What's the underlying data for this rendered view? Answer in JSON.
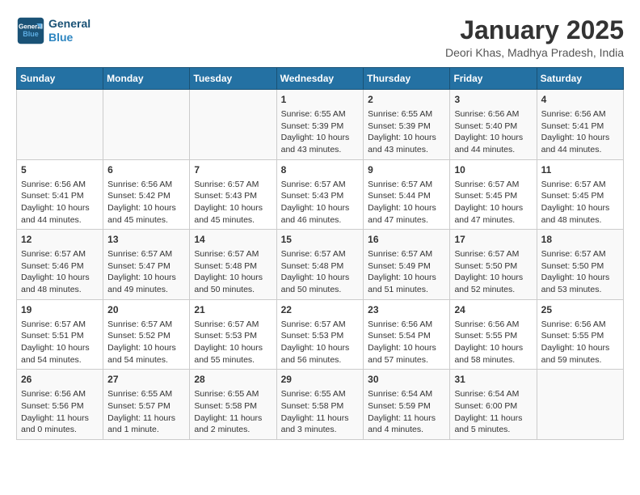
{
  "logo": {
    "line1": "General",
    "line2": "Blue"
  },
  "title": "January 2025",
  "subtitle": "Deori Khas, Madhya Pradesh, India",
  "days_of_week": [
    "Sunday",
    "Monday",
    "Tuesday",
    "Wednesday",
    "Thursday",
    "Friday",
    "Saturday"
  ],
  "weeks": [
    [
      {
        "day": "",
        "sunrise": "",
        "sunset": "",
        "daylight": ""
      },
      {
        "day": "",
        "sunrise": "",
        "sunset": "",
        "daylight": ""
      },
      {
        "day": "",
        "sunrise": "",
        "sunset": "",
        "daylight": ""
      },
      {
        "day": "1",
        "sunrise": "Sunrise: 6:55 AM",
        "sunset": "Sunset: 5:39 PM",
        "daylight": "Daylight: 10 hours and 43 minutes."
      },
      {
        "day": "2",
        "sunrise": "Sunrise: 6:55 AM",
        "sunset": "Sunset: 5:39 PM",
        "daylight": "Daylight: 10 hours and 43 minutes."
      },
      {
        "day": "3",
        "sunrise": "Sunrise: 6:56 AM",
        "sunset": "Sunset: 5:40 PM",
        "daylight": "Daylight: 10 hours and 44 minutes."
      },
      {
        "day": "4",
        "sunrise": "Sunrise: 6:56 AM",
        "sunset": "Sunset: 5:41 PM",
        "daylight": "Daylight: 10 hours and 44 minutes."
      }
    ],
    [
      {
        "day": "5",
        "sunrise": "Sunrise: 6:56 AM",
        "sunset": "Sunset: 5:41 PM",
        "daylight": "Daylight: 10 hours and 44 minutes."
      },
      {
        "day": "6",
        "sunrise": "Sunrise: 6:56 AM",
        "sunset": "Sunset: 5:42 PM",
        "daylight": "Daylight: 10 hours and 45 minutes."
      },
      {
        "day": "7",
        "sunrise": "Sunrise: 6:57 AM",
        "sunset": "Sunset: 5:43 PM",
        "daylight": "Daylight: 10 hours and 45 minutes."
      },
      {
        "day": "8",
        "sunrise": "Sunrise: 6:57 AM",
        "sunset": "Sunset: 5:43 PM",
        "daylight": "Daylight: 10 hours and 46 minutes."
      },
      {
        "day": "9",
        "sunrise": "Sunrise: 6:57 AM",
        "sunset": "Sunset: 5:44 PM",
        "daylight": "Daylight: 10 hours and 47 minutes."
      },
      {
        "day": "10",
        "sunrise": "Sunrise: 6:57 AM",
        "sunset": "Sunset: 5:45 PM",
        "daylight": "Daylight: 10 hours and 47 minutes."
      },
      {
        "day": "11",
        "sunrise": "Sunrise: 6:57 AM",
        "sunset": "Sunset: 5:45 PM",
        "daylight": "Daylight: 10 hours and 48 minutes."
      }
    ],
    [
      {
        "day": "12",
        "sunrise": "Sunrise: 6:57 AM",
        "sunset": "Sunset: 5:46 PM",
        "daylight": "Daylight: 10 hours and 48 minutes."
      },
      {
        "day": "13",
        "sunrise": "Sunrise: 6:57 AM",
        "sunset": "Sunset: 5:47 PM",
        "daylight": "Daylight: 10 hours and 49 minutes."
      },
      {
        "day": "14",
        "sunrise": "Sunrise: 6:57 AM",
        "sunset": "Sunset: 5:48 PM",
        "daylight": "Daylight: 10 hours and 50 minutes."
      },
      {
        "day": "15",
        "sunrise": "Sunrise: 6:57 AM",
        "sunset": "Sunset: 5:48 PM",
        "daylight": "Daylight: 10 hours and 50 minutes."
      },
      {
        "day": "16",
        "sunrise": "Sunrise: 6:57 AM",
        "sunset": "Sunset: 5:49 PM",
        "daylight": "Daylight: 10 hours and 51 minutes."
      },
      {
        "day": "17",
        "sunrise": "Sunrise: 6:57 AM",
        "sunset": "Sunset: 5:50 PM",
        "daylight": "Daylight: 10 hours and 52 minutes."
      },
      {
        "day": "18",
        "sunrise": "Sunrise: 6:57 AM",
        "sunset": "Sunset: 5:50 PM",
        "daylight": "Daylight: 10 hours and 53 minutes."
      }
    ],
    [
      {
        "day": "19",
        "sunrise": "Sunrise: 6:57 AM",
        "sunset": "Sunset: 5:51 PM",
        "daylight": "Daylight: 10 hours and 54 minutes."
      },
      {
        "day": "20",
        "sunrise": "Sunrise: 6:57 AM",
        "sunset": "Sunset: 5:52 PM",
        "daylight": "Daylight: 10 hours and 54 minutes."
      },
      {
        "day": "21",
        "sunrise": "Sunrise: 6:57 AM",
        "sunset": "Sunset: 5:53 PM",
        "daylight": "Daylight: 10 hours and 55 minutes."
      },
      {
        "day": "22",
        "sunrise": "Sunrise: 6:57 AM",
        "sunset": "Sunset: 5:53 PM",
        "daylight": "Daylight: 10 hours and 56 minutes."
      },
      {
        "day": "23",
        "sunrise": "Sunrise: 6:56 AM",
        "sunset": "Sunset: 5:54 PM",
        "daylight": "Daylight: 10 hours and 57 minutes."
      },
      {
        "day": "24",
        "sunrise": "Sunrise: 6:56 AM",
        "sunset": "Sunset: 5:55 PM",
        "daylight": "Daylight: 10 hours and 58 minutes."
      },
      {
        "day": "25",
        "sunrise": "Sunrise: 6:56 AM",
        "sunset": "Sunset: 5:55 PM",
        "daylight": "Daylight: 10 hours and 59 minutes."
      }
    ],
    [
      {
        "day": "26",
        "sunrise": "Sunrise: 6:56 AM",
        "sunset": "Sunset: 5:56 PM",
        "daylight": "Daylight: 11 hours and 0 minutes."
      },
      {
        "day": "27",
        "sunrise": "Sunrise: 6:55 AM",
        "sunset": "Sunset: 5:57 PM",
        "daylight": "Daylight: 11 hours and 1 minute."
      },
      {
        "day": "28",
        "sunrise": "Sunrise: 6:55 AM",
        "sunset": "Sunset: 5:58 PM",
        "daylight": "Daylight: 11 hours and 2 minutes."
      },
      {
        "day": "29",
        "sunrise": "Sunrise: 6:55 AM",
        "sunset": "Sunset: 5:58 PM",
        "daylight": "Daylight: 11 hours and 3 minutes."
      },
      {
        "day": "30",
        "sunrise": "Sunrise: 6:54 AM",
        "sunset": "Sunset: 5:59 PM",
        "daylight": "Daylight: 11 hours and 4 minutes."
      },
      {
        "day": "31",
        "sunrise": "Sunrise: 6:54 AM",
        "sunset": "Sunset: 6:00 PM",
        "daylight": "Daylight: 11 hours and 5 minutes."
      },
      {
        "day": "",
        "sunrise": "",
        "sunset": "",
        "daylight": ""
      }
    ]
  ]
}
